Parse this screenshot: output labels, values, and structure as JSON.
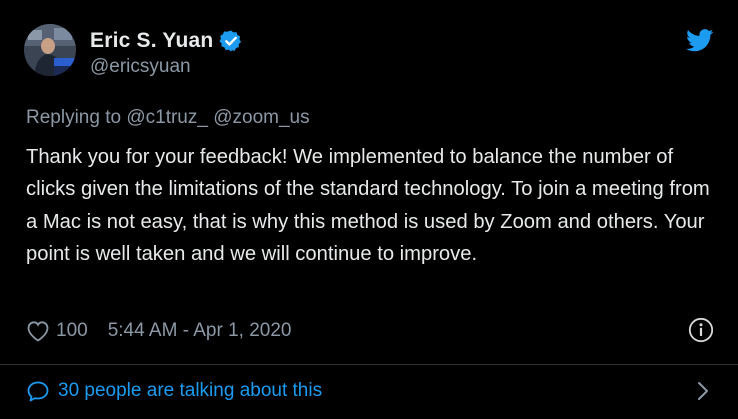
{
  "author": {
    "display_name": "Eric S. Yuan",
    "handle": "@ericsyuan",
    "verified": true,
    "avatar_icon": "avatar-photo"
  },
  "reply": {
    "prefix": "Replying to",
    "mentions": [
      "@c1truz_",
      "@zoom_us"
    ]
  },
  "tweet": {
    "text": "Thank you for your feedback! We implemented to balance the number of clicks given the limitations of the standard technology. To join a meeting from a Mac is not easy, that is why this method is used by Zoom and others. Your point is well taken and we will continue to improve."
  },
  "meta": {
    "like_count": "100",
    "timestamp": "5:44 AM - Apr 1, 2020"
  },
  "conversation": {
    "label": "30 people are talking about this"
  },
  "colors": {
    "background": "#000000",
    "text": "#e7e9ea",
    "secondary": "#8b98a5",
    "accent": "#1d9bf0",
    "divider": "#2f3336"
  },
  "icons": {
    "verified": "verified-badge-icon",
    "brand": "twitter-bird-icon",
    "like": "heart-icon",
    "info": "info-icon",
    "reply": "speech-bubble-icon",
    "more": "chevron-right-icon"
  }
}
